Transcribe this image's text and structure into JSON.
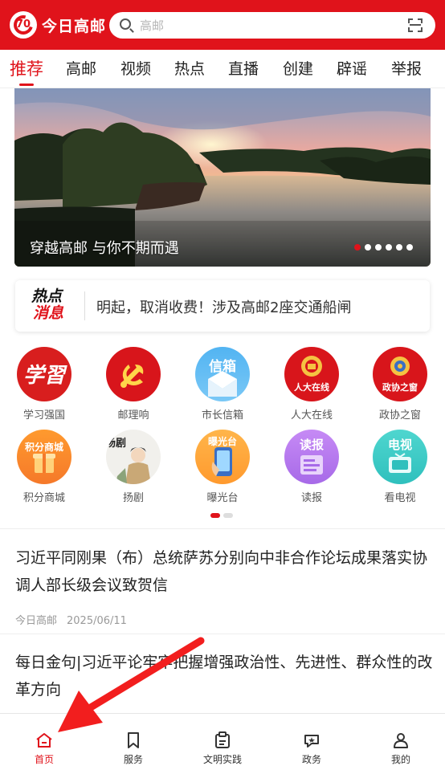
{
  "header": {
    "logo_text": "今日高邮",
    "logo_mark": "70",
    "search_placeholder": "高邮"
  },
  "tabs": [
    {
      "label": "推荐",
      "active": true
    },
    {
      "label": "高邮"
    },
    {
      "label": "视频"
    },
    {
      "label": "热点"
    },
    {
      "label": "直播"
    },
    {
      "label": "创建"
    },
    {
      "label": "辟谣"
    },
    {
      "label": "举报"
    }
  ],
  "banner": {
    "caption": "穿越高邮 与你不期而遇",
    "dot_count": 6,
    "active_dot": 0
  },
  "hot_news": {
    "badge_line1": "热点",
    "badge_line2": "消息",
    "text": "明起，取消收费！涉及高邮2座交通船闸"
  },
  "services": [
    {
      "label": "学习强国",
      "icon": "xuexi-icon",
      "glyph": "学習"
    },
    {
      "label": "邮理响",
      "icon": "party-emblem-icon",
      "glyph": ""
    },
    {
      "label": "市长信箱",
      "icon": "mailbox-icon",
      "glyph": "信箱"
    },
    {
      "label": "人大在线",
      "icon": "npc-emblem-icon",
      "glyph": "人大在线"
    },
    {
      "label": "政协之窗",
      "icon": "cppcc-emblem-icon",
      "glyph": "政协之窗"
    },
    {
      "label": "积分商城",
      "icon": "points-mall-icon",
      "glyph": "积分商城"
    },
    {
      "label": "扬剧",
      "icon": "opera-icon",
      "glyph": "扬剧"
    },
    {
      "label": "曝光台",
      "icon": "phone-icon",
      "glyph": "曝光台"
    },
    {
      "label": "读报",
      "icon": "newspaper-icon",
      "glyph": "读报"
    },
    {
      "label": "看电视",
      "icon": "tv-icon",
      "glyph": "电视"
    }
  ],
  "grid_page": {
    "count": 2,
    "active": 0
  },
  "articles": [
    {
      "title": "习近平同刚果（布）总统萨苏分别向中非合作论坛成果落实协调人部长级会议致贺信",
      "source": "今日高邮",
      "date": "2025/06/11"
    },
    {
      "title": "每日金句|习近平论牢牢把握增强政治性、先进性、群众性的改革方向",
      "source": "",
      "date": ""
    }
  ],
  "bottom_nav": [
    {
      "label": "首页",
      "icon": "home-icon",
      "active": true
    },
    {
      "label": "服务",
      "icon": "bookmark-icon"
    },
    {
      "label": "文明实践",
      "icon": "clipboard-icon"
    },
    {
      "label": "政务",
      "icon": "gov-icon"
    },
    {
      "label": "我的",
      "icon": "user-icon"
    }
  ],
  "colors": {
    "brand": "#e0131b",
    "text": "#222222",
    "muted": "#999999"
  }
}
